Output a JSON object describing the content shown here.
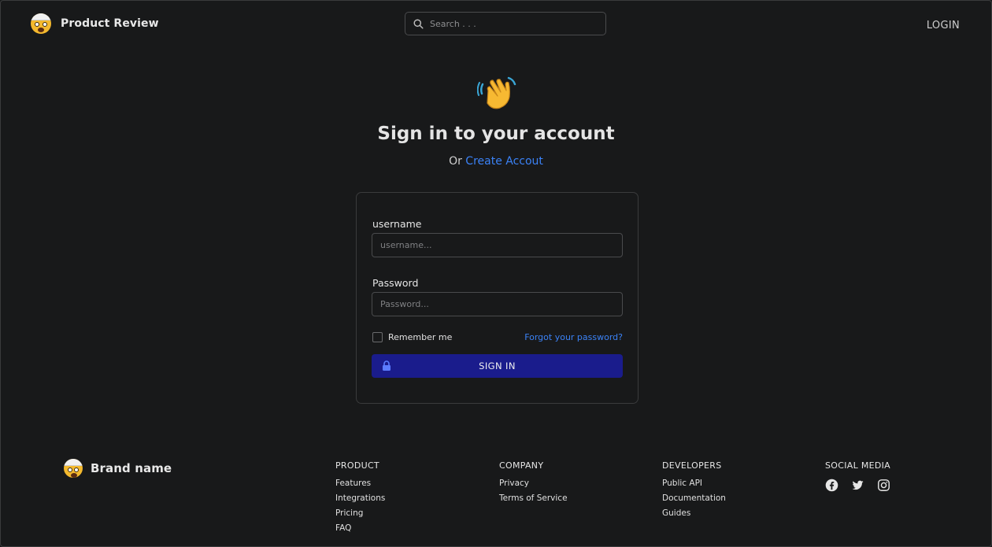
{
  "header": {
    "brand_name": "Product Review",
    "search_placeholder": "Search . . .",
    "login_label": "LOGIN"
  },
  "hero": {
    "title": "Sign in to your account",
    "subtitle_prefix": "Or",
    "create_account_label": "Create Accout"
  },
  "form": {
    "username_label": "username",
    "username_placeholder": "username...",
    "password_label": "Password",
    "password_placeholder": "Password...",
    "remember_label": "Remember me",
    "forgot_label": "Forgot your password?",
    "signin_label": "SIGN IN"
  },
  "footer": {
    "brand_name": "Brand name",
    "columns": [
      {
        "heading": "PRODUCT",
        "items": [
          "Features",
          "Integrations",
          "Pricing",
          "FAQ"
        ]
      },
      {
        "heading": "COMPANY",
        "items": [
          "Privacy",
          "Terms of Service"
        ]
      },
      {
        "heading": "DEVELOPERS",
        "items": [
          "Public API",
          "Documentation",
          "Guides"
        ]
      },
      {
        "heading": "SOCIAL MEDIA",
        "icons": [
          "facebook-icon",
          "twitter-icon",
          "instagram-icon"
        ]
      }
    ]
  },
  "colors": {
    "background": "#18191a",
    "accent_blue": "#3b82f6",
    "signin_button": "#1a1c8c",
    "border": "#3a3b3c"
  }
}
